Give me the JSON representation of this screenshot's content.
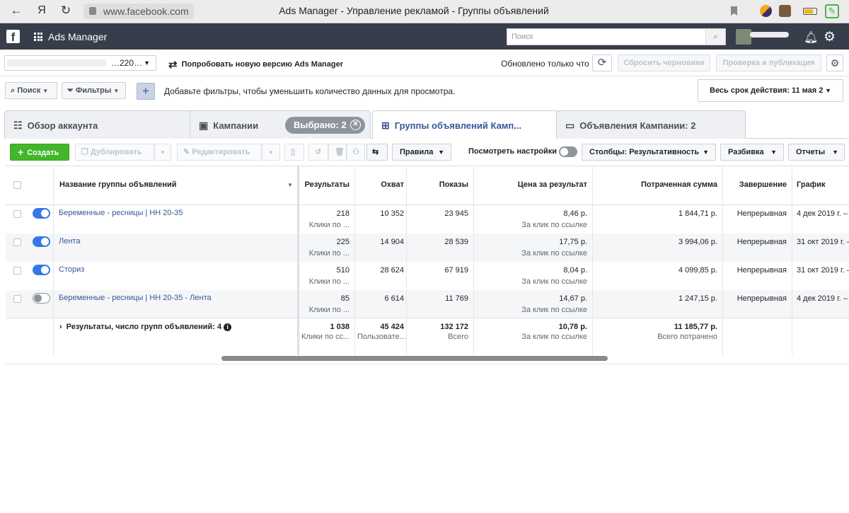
{
  "browser": {
    "url": "www.facebook.com",
    "page_title": "Ads Manager - Управление рекламой - Группы объявлений",
    "yandex_letter": "Я"
  },
  "fb_header": {
    "app_name": "Ads Manager",
    "search_placeholder": "Поиск"
  },
  "toolbar": {
    "account_tail": "…220…",
    "try_new": "Попробовать новую версию Ads Manager",
    "updated": "Обновлено только что",
    "discard_drafts": "Сбросить черновики",
    "review_publish": "Проверка и публикация"
  },
  "filters": {
    "search_btn": "Поиск",
    "filters_btn": "Фильтры",
    "hint": "Добавьте фильтры, чтобы уменьшить количество данных для просмотра.",
    "date_range": "Весь срок действия: 11 мая 2"
  },
  "tabs": {
    "account_overview": "Обзор аккаунта",
    "campaigns": "Кампании",
    "selected": "Выбрано: 2",
    "ad_sets": "Группы объявлений Камп...",
    "ads": "Объявления Кампании: 2"
  },
  "actions": {
    "create": "Создать",
    "duplicate": "Дублировать",
    "edit": "Редактировать",
    "rules": "Правила",
    "view_settings": "Посмотреть настройки",
    "columns": "Столбцы: Результативность",
    "breakdown": "Разбивка",
    "reports": "Отчеты"
  },
  "table": {
    "headers": {
      "name": "Название группы объявлений",
      "results": "Результаты",
      "reach": "Охват",
      "impressions": "Показы",
      "cost_per_result": "Цена за результат",
      "amount_spent": "Потраченная сумма",
      "ends": "Завершение",
      "schedule": "График"
    },
    "rows": [
      {
        "name": "Беременные - ресницы | НН 20-35",
        "results": "218",
        "results_sub": "Клики по ...",
        "reach": "10 352",
        "impressions": "23 945",
        "cpr": "8,46 р.",
        "cpr_sub": "За клик по ссылке",
        "spent": "1 844,71 р.",
        "ends": "Непрерывная",
        "schedule": "4 дек 2019 г. –"
      },
      {
        "name": "Лента",
        "results": "225",
        "results_sub": "Клики по ...",
        "reach": "14 904",
        "impressions": "28 539",
        "cpr": "17,75 р.",
        "cpr_sub": "За клик по ссылке",
        "spent": "3 994,06 р.",
        "ends": "Непрерывная",
        "schedule": "31 окт 2019 г. –"
      },
      {
        "name": "Сториз",
        "results": "510",
        "results_sub": "Клики по ...",
        "reach": "28 624",
        "impressions": "67 919",
        "cpr": "8,04 р.",
        "cpr_sub": "За клик по ссылке",
        "spent": "4 099,85 р.",
        "ends": "Непрерывная",
        "schedule": "31 окт 2019 г. –"
      },
      {
        "name": "Беременные - ресницы | НН 20-35 - Лента",
        "results": "85",
        "results_sub": "Клики по ...",
        "reach": "6 614",
        "impressions": "11 769",
        "cpr": "14,67 р.",
        "cpr_sub": "За клик по ссылке",
        "spent": "1 247,15 р.",
        "ends": "Непрерывная",
        "schedule": "4 дек 2019 г. –"
      }
    ],
    "totals": {
      "label": "Результаты, число групп объявлений: 4",
      "results": "1 038",
      "results_sub": "Клики по сс...",
      "reach": "45 424",
      "reach_sub": "Пользовате...",
      "impressions": "132 172",
      "impressions_sub": "Всего",
      "cpr": "10,78 р.",
      "cpr_sub": "За клик по ссылке",
      "spent": "11 185,77 р.",
      "spent_sub": "Всего потрачено"
    }
  }
}
